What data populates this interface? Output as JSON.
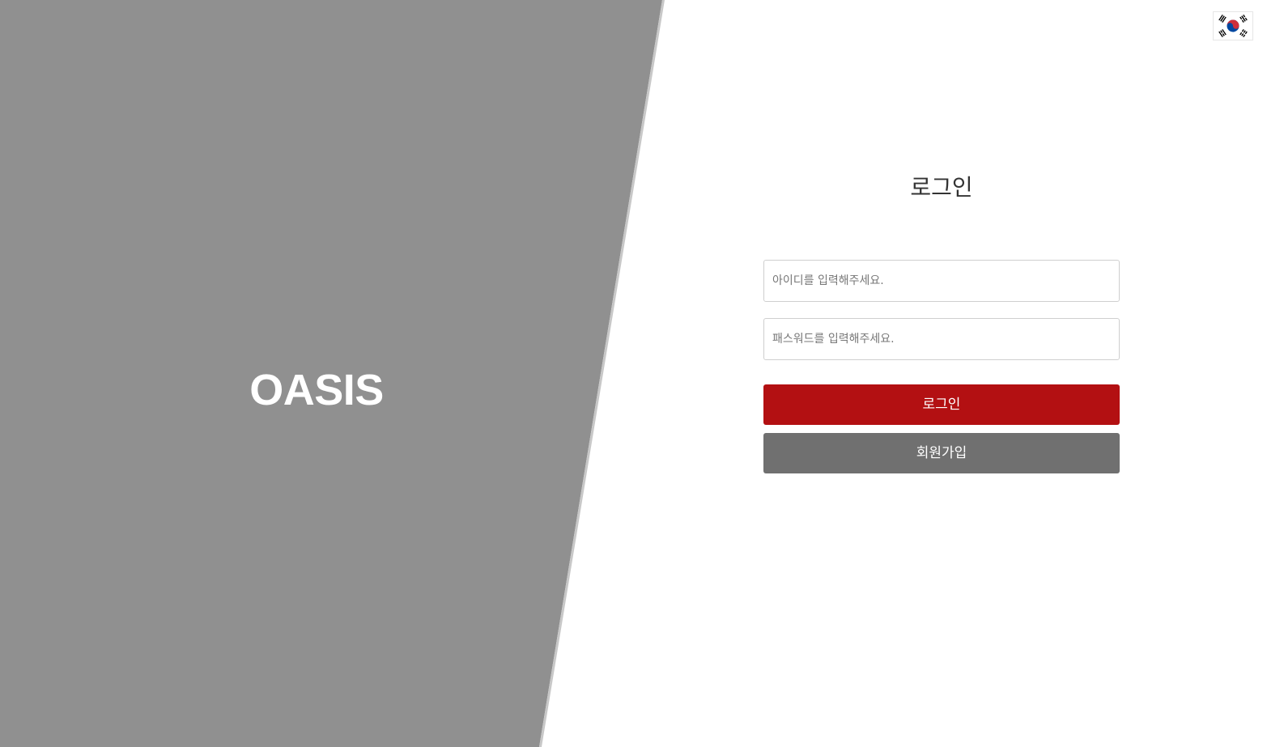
{
  "brand": {
    "name": "OASIS"
  },
  "language": {
    "icon": "south-korea-flag-icon"
  },
  "login": {
    "title": "로그인",
    "id_placeholder": "아이디를 입력해주세요.",
    "id_value": "",
    "password_placeholder": "패스워드를 입력해주세요.",
    "password_value": "",
    "login_button": "로그인",
    "signup_button": "회원가입"
  },
  "colors": {
    "left_panel": "#909090",
    "login_button": "#b31012",
    "signup_button": "#707070",
    "background": "#ffffff"
  }
}
